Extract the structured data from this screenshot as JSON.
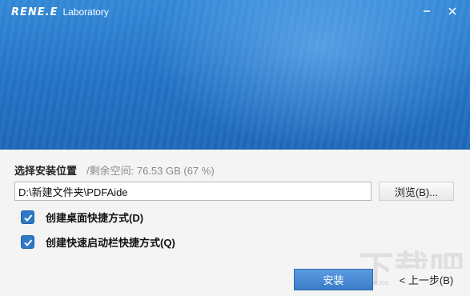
{
  "header": {
    "brand_logo": "RENE.E",
    "brand_sub": "Laboratory",
    "minimize_symbol": "—",
    "close_symbol": "✕"
  },
  "install": {
    "location_label": "选择安装位置",
    "free_space": "/剩余空间: 76.53 GB (67 %)",
    "path_value": "D:\\新建文件夹\\PDFAide",
    "browse_label": "浏览(B)..."
  },
  "options": [
    {
      "label": "创建桌面快捷方式(D)",
      "checked": true
    },
    {
      "label": "创建快速启动栏快捷方式(Q)",
      "checked": true
    }
  ],
  "footer": {
    "install_label": "安装",
    "back_label": "< 上一步(B)"
  },
  "watermark": {
    "text": "下载吧",
    "sub": "www.xiazaiba.com"
  },
  "colors": {
    "banner": "#1f6fc3",
    "accent": "#3a7cc8",
    "checkbox": "#2e79c7"
  },
  "icons": [
    "minimize-icon",
    "close-icon",
    "checkmark-icon"
  ]
}
